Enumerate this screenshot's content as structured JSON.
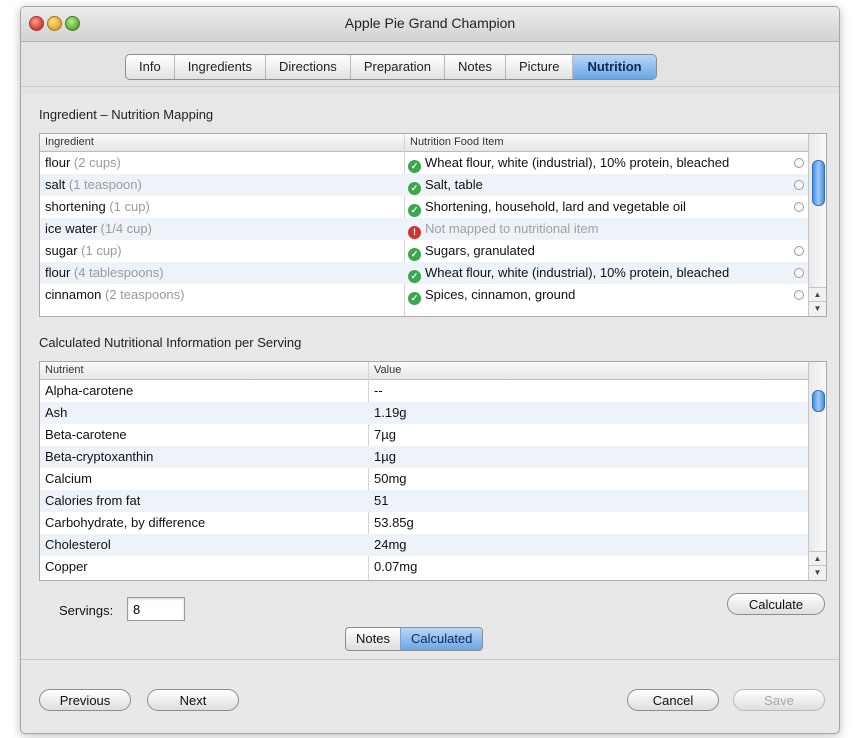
{
  "window": {
    "title": "Apple Pie Grand Champion"
  },
  "tabs": [
    {
      "label": "Info"
    },
    {
      "label": "Ingredients"
    },
    {
      "label": "Directions"
    },
    {
      "label": "Preparation"
    },
    {
      "label": "Notes"
    },
    {
      "label": "Picture"
    },
    {
      "label": "Nutrition",
      "selected": true
    }
  ],
  "mapping": {
    "title": "Ingredient – Nutrition Mapping",
    "col_ingredient": "Ingredient",
    "col_food": "Nutrition Food Item",
    "rows": [
      {
        "ingredient": "flour",
        "qty": "(2 cups)",
        "status": "ok",
        "food": "Wheat flour, white (industrial), 10% protein, bleached"
      },
      {
        "ingredient": "salt",
        "qty": "(1 teaspoon)",
        "status": "ok",
        "food": "Salt, table"
      },
      {
        "ingredient": "shortening",
        "qty": "(1 cup)",
        "status": "ok",
        "food": "Shortening, household, lard and vegetable oil"
      },
      {
        "ingredient": "ice water",
        "qty": "(1/4 cup)",
        "status": "unmapped",
        "food": "Not mapped to nutritional item"
      },
      {
        "ingredient": "sugar",
        "qty": "(1 cup)",
        "status": "ok",
        "food": "Sugars, granulated"
      },
      {
        "ingredient": "flour",
        "qty": "(4 tablespoons)",
        "status": "ok",
        "food": "Wheat flour, white (industrial), 10% protein, bleached"
      },
      {
        "ingredient": "cinnamon",
        "qty": "(2 teaspoons)",
        "status": "ok",
        "food": "Spices, cinnamon, ground"
      }
    ]
  },
  "nutrition": {
    "title": "Calculated Nutritional Information per Serving",
    "col_nutrient": "Nutrient",
    "col_value": "Value",
    "rows": [
      {
        "nutrient": "Alpha-carotene",
        "value": "--"
      },
      {
        "nutrient": "Ash",
        "value": "1.19g"
      },
      {
        "nutrient": "Beta-carotene",
        "value": "7µg"
      },
      {
        "nutrient": "Beta-cryptoxanthin",
        "value": "1µg"
      },
      {
        "nutrient": "Calcium",
        "value": "50mg"
      },
      {
        "nutrient": "Calories from fat",
        "value": "51"
      },
      {
        "nutrient": "Carbohydrate, by difference",
        "value": "53.85g"
      },
      {
        "nutrient": "Cholesterol",
        "value": "24mg"
      },
      {
        "nutrient": "Copper",
        "value": "0.07mg"
      }
    ]
  },
  "servings": {
    "label": "Servings:",
    "value": "8"
  },
  "buttons": {
    "calculate": "Calculate",
    "previous": "Previous",
    "next": "Next",
    "cancel": "Cancel",
    "save": "Save"
  },
  "segment": [
    {
      "label": "Notes"
    },
    {
      "label": "Calculated",
      "selected": true
    }
  ],
  "icons": {
    "ok": "check-circle-icon",
    "unmapped": "exclamation-circle-icon"
  },
  "colors": {
    "selected_blue": "#6aa6e8",
    "ok_green": "#39a84a",
    "error_red": "#d0342c"
  }
}
